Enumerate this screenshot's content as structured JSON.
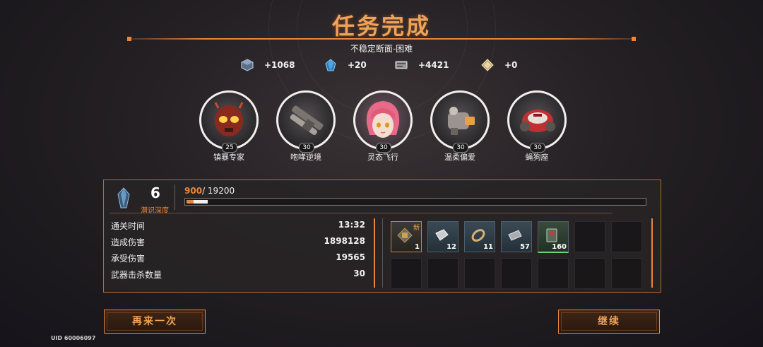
{
  "header": {
    "title": "任务完成",
    "subtitle": "不稳定断面-困难"
  },
  "rewards": [
    {
      "icon": "cube-resource-icon",
      "value": "+1068",
      "color": "#7a8fa8"
    },
    {
      "icon": "crystal-resource-icon",
      "value": "+20",
      "color": "#3a8fc8"
    },
    {
      "icon": "card-resource-icon",
      "value": "+4421",
      "color": "#b8b8b8"
    },
    {
      "icon": "gem-resource-icon",
      "value": "+0",
      "color": "#d8c090"
    }
  ],
  "weapons": [
    {
      "name": "镇暴专家",
      "level": "25",
      "icon": "helmet-weapon-icon"
    },
    {
      "name": "咆哮逆境",
      "level": "30",
      "icon": "launcher-weapon-icon"
    },
    {
      "name": "灵态飞行",
      "level": "30",
      "icon": "character-portrait-icon"
    },
    {
      "name": "温柔偏爱",
      "level": "30",
      "icon": "gauntlet-weapon-icon"
    },
    {
      "name": "蝇狗座",
      "level": "30",
      "icon": "red-drone-weapon-icon"
    }
  ],
  "progress": {
    "level": "6",
    "level_label": "潜识深度",
    "xp_current": "900",
    "xp_total": "/ 19200",
    "xp_fraction": 0.0469
  },
  "stats": [
    {
      "label": "通关时间",
      "value": "13:32"
    },
    {
      "label": "造成伤害",
      "value": "1898128"
    },
    {
      "label": "承受伤害",
      "value": "19565"
    },
    {
      "label": "武器击杀数量",
      "value": "30"
    }
  ],
  "loot": [
    {
      "count": "1",
      "new": "新",
      "rarity": "gold"
    },
    {
      "count": "12",
      "new": "",
      "rarity": "blue"
    },
    {
      "count": "11",
      "new": "",
      "rarity": "blue"
    },
    {
      "count": "57",
      "new": "",
      "rarity": "blue"
    },
    {
      "count": "160",
      "new": "",
      "rarity": "green"
    }
  ],
  "buttons": {
    "retry": "再来一次",
    "continue": "继续"
  },
  "footer": {
    "uid": "UID 60006097"
  }
}
